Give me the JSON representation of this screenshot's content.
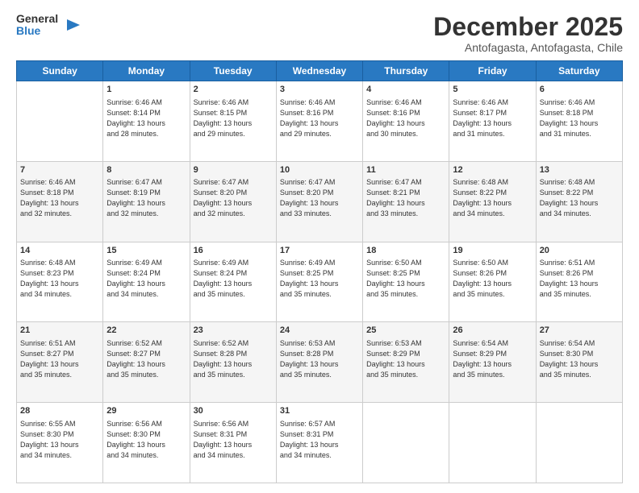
{
  "header": {
    "logo_line1": "General",
    "logo_line2": "Blue",
    "month_year": "December 2025",
    "location": "Antofagasta, Antofagasta, Chile"
  },
  "days_of_week": [
    "Sunday",
    "Monday",
    "Tuesday",
    "Wednesday",
    "Thursday",
    "Friday",
    "Saturday"
  ],
  "weeks": [
    [
      {
        "day": "",
        "info": ""
      },
      {
        "day": "1",
        "info": "Sunrise: 6:46 AM\nSunset: 8:14 PM\nDaylight: 13 hours\nand 28 minutes."
      },
      {
        "day": "2",
        "info": "Sunrise: 6:46 AM\nSunset: 8:15 PM\nDaylight: 13 hours\nand 29 minutes."
      },
      {
        "day": "3",
        "info": "Sunrise: 6:46 AM\nSunset: 8:16 PM\nDaylight: 13 hours\nand 29 minutes."
      },
      {
        "day": "4",
        "info": "Sunrise: 6:46 AM\nSunset: 8:16 PM\nDaylight: 13 hours\nand 30 minutes."
      },
      {
        "day": "5",
        "info": "Sunrise: 6:46 AM\nSunset: 8:17 PM\nDaylight: 13 hours\nand 31 minutes."
      },
      {
        "day": "6",
        "info": "Sunrise: 6:46 AM\nSunset: 8:18 PM\nDaylight: 13 hours\nand 31 minutes."
      }
    ],
    [
      {
        "day": "7",
        "info": "Sunrise: 6:46 AM\nSunset: 8:18 PM\nDaylight: 13 hours\nand 32 minutes."
      },
      {
        "day": "8",
        "info": "Sunrise: 6:47 AM\nSunset: 8:19 PM\nDaylight: 13 hours\nand 32 minutes."
      },
      {
        "day": "9",
        "info": "Sunrise: 6:47 AM\nSunset: 8:20 PM\nDaylight: 13 hours\nand 32 minutes."
      },
      {
        "day": "10",
        "info": "Sunrise: 6:47 AM\nSunset: 8:20 PM\nDaylight: 13 hours\nand 33 minutes."
      },
      {
        "day": "11",
        "info": "Sunrise: 6:47 AM\nSunset: 8:21 PM\nDaylight: 13 hours\nand 33 minutes."
      },
      {
        "day": "12",
        "info": "Sunrise: 6:48 AM\nSunset: 8:22 PM\nDaylight: 13 hours\nand 34 minutes."
      },
      {
        "day": "13",
        "info": "Sunrise: 6:48 AM\nSunset: 8:22 PM\nDaylight: 13 hours\nand 34 minutes."
      }
    ],
    [
      {
        "day": "14",
        "info": "Sunrise: 6:48 AM\nSunset: 8:23 PM\nDaylight: 13 hours\nand 34 minutes."
      },
      {
        "day": "15",
        "info": "Sunrise: 6:49 AM\nSunset: 8:24 PM\nDaylight: 13 hours\nand 34 minutes."
      },
      {
        "day": "16",
        "info": "Sunrise: 6:49 AM\nSunset: 8:24 PM\nDaylight: 13 hours\nand 35 minutes."
      },
      {
        "day": "17",
        "info": "Sunrise: 6:49 AM\nSunset: 8:25 PM\nDaylight: 13 hours\nand 35 minutes."
      },
      {
        "day": "18",
        "info": "Sunrise: 6:50 AM\nSunset: 8:25 PM\nDaylight: 13 hours\nand 35 minutes."
      },
      {
        "day": "19",
        "info": "Sunrise: 6:50 AM\nSunset: 8:26 PM\nDaylight: 13 hours\nand 35 minutes."
      },
      {
        "day": "20",
        "info": "Sunrise: 6:51 AM\nSunset: 8:26 PM\nDaylight: 13 hours\nand 35 minutes."
      }
    ],
    [
      {
        "day": "21",
        "info": "Sunrise: 6:51 AM\nSunset: 8:27 PM\nDaylight: 13 hours\nand 35 minutes."
      },
      {
        "day": "22",
        "info": "Sunrise: 6:52 AM\nSunset: 8:27 PM\nDaylight: 13 hours\nand 35 minutes."
      },
      {
        "day": "23",
        "info": "Sunrise: 6:52 AM\nSunset: 8:28 PM\nDaylight: 13 hours\nand 35 minutes."
      },
      {
        "day": "24",
        "info": "Sunrise: 6:53 AM\nSunset: 8:28 PM\nDaylight: 13 hours\nand 35 minutes."
      },
      {
        "day": "25",
        "info": "Sunrise: 6:53 AM\nSunset: 8:29 PM\nDaylight: 13 hours\nand 35 minutes."
      },
      {
        "day": "26",
        "info": "Sunrise: 6:54 AM\nSunset: 8:29 PM\nDaylight: 13 hours\nand 35 minutes."
      },
      {
        "day": "27",
        "info": "Sunrise: 6:54 AM\nSunset: 8:30 PM\nDaylight: 13 hours\nand 35 minutes."
      }
    ],
    [
      {
        "day": "28",
        "info": "Sunrise: 6:55 AM\nSunset: 8:30 PM\nDaylight: 13 hours\nand 34 minutes."
      },
      {
        "day": "29",
        "info": "Sunrise: 6:56 AM\nSunset: 8:30 PM\nDaylight: 13 hours\nand 34 minutes."
      },
      {
        "day": "30",
        "info": "Sunrise: 6:56 AM\nSunset: 8:31 PM\nDaylight: 13 hours\nand 34 minutes."
      },
      {
        "day": "31",
        "info": "Sunrise: 6:57 AM\nSunset: 8:31 PM\nDaylight: 13 hours\nand 34 minutes."
      },
      {
        "day": "",
        "info": ""
      },
      {
        "day": "",
        "info": ""
      },
      {
        "day": "",
        "info": ""
      }
    ]
  ]
}
